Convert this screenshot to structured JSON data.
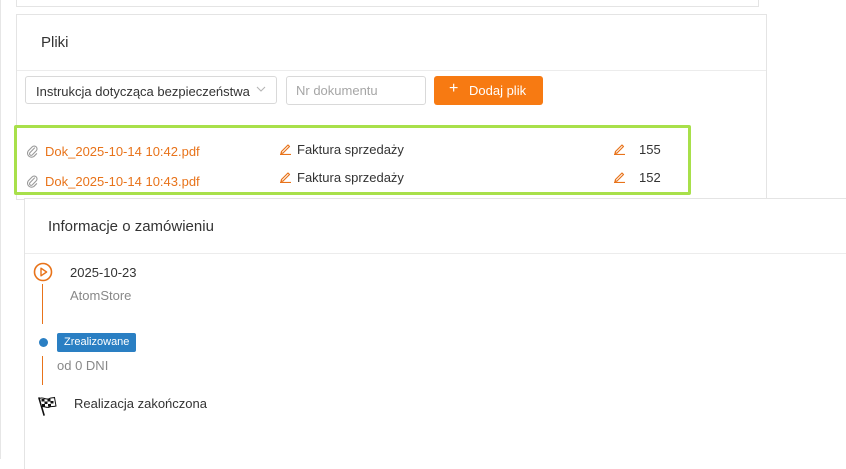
{
  "files_panel": {
    "title": "Pliki",
    "category_select": {
      "value": "Instrukcja dotycząca bezpieczeństwa"
    },
    "document_number_input": {
      "placeholder": "Nr dokumentu",
      "value": ""
    },
    "add_file_button": {
      "label": "Dodaj plik",
      "icon": "plus-icon"
    },
    "files": [
      {
        "name": "Dok_2025-10-14 10:42.pdf",
        "type": "Faktura sprzedaży",
        "number": "155"
      },
      {
        "name": "Dok_2025-10-14 10:43.pdf",
        "type": "Faktura sprzedaży",
        "number": "152"
      }
    ]
  },
  "order_info": {
    "title": "Informacje o zamówieniu",
    "timeline": {
      "start_date": "2025-10-23",
      "source": "AtomStore",
      "status_badge": "Zrealizowane",
      "status_since": "od 0 DNI",
      "end_label": "Realizacja zakończona"
    }
  },
  "colors": {
    "accent_orange": "#f77a12",
    "link_orange": "#e8731a",
    "status_blue": "#2a7fc3",
    "highlight_green": "#a8e04a"
  }
}
